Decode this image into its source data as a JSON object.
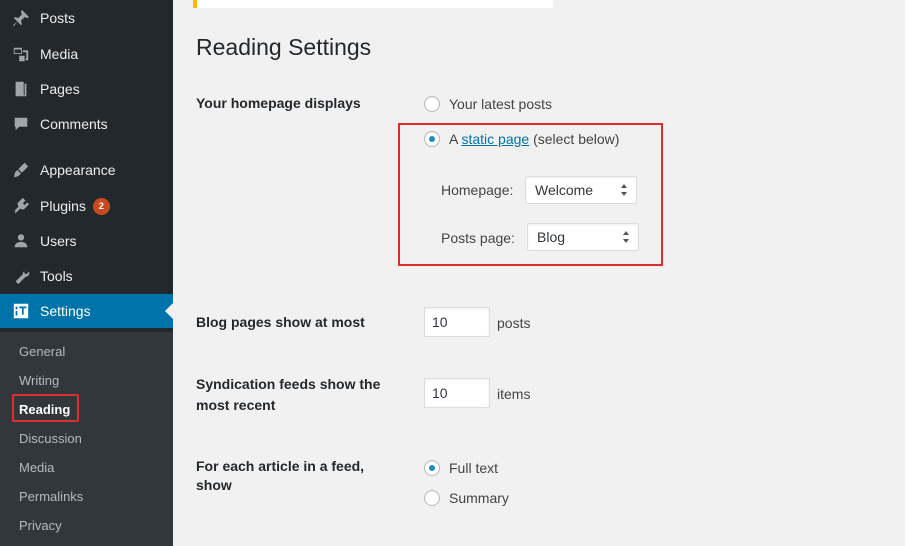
{
  "sidebar": {
    "items": [
      {
        "label": "Posts",
        "icon": "pin-icon"
      },
      {
        "label": "Media",
        "icon": "media-icon"
      },
      {
        "label": "Pages",
        "icon": "pages-icon"
      },
      {
        "label": "Comments",
        "icon": "comments-icon"
      },
      {
        "label": "Appearance",
        "icon": "appearance-icon"
      },
      {
        "label": "Plugins",
        "icon": "plugins-icon",
        "badge": "2"
      },
      {
        "label": "Users",
        "icon": "users-icon"
      },
      {
        "label": "Tools",
        "icon": "tools-icon"
      },
      {
        "label": "Settings",
        "icon": "settings-icon",
        "active": true
      }
    ],
    "submenu": [
      "General",
      "Writing",
      "Reading",
      "Discussion",
      "Media",
      "Permalinks",
      "Privacy"
    ],
    "current_submenu": "Reading"
  },
  "page": {
    "title": "Reading Settings",
    "homepage_displays": {
      "label": "Your homepage displays",
      "option_latest": "Your latest posts",
      "option_static_prefix": "A ",
      "option_static_link": "static page",
      "option_static_suffix": " (select below)",
      "selected": "static",
      "homepage_label": "Homepage:",
      "homepage_value": "Welcome",
      "posts_page_label": "Posts page:",
      "posts_page_value": "Blog"
    },
    "blog_pages": {
      "label": "Blog pages show at most",
      "value": "10",
      "unit": "posts"
    },
    "syndication": {
      "label_line1": "Syndication feeds show the",
      "label_line2": "most recent",
      "value": "10",
      "unit": "items"
    },
    "feed_article": {
      "label_line1": "For each article in a feed,",
      "label_line2": "show",
      "option_full": "Full text",
      "option_summary": "Summary",
      "selected": "full"
    }
  },
  "colors": {
    "accent": "#0073aa",
    "highlight": "#dd2d2d",
    "sidebar": "#23282d",
    "badge": "#ca4a1f"
  }
}
